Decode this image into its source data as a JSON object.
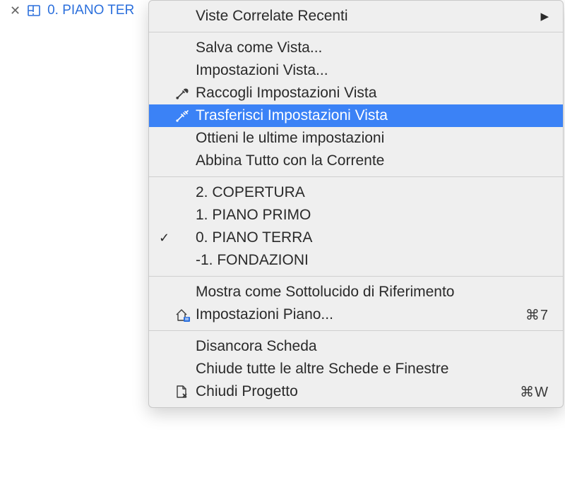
{
  "tab": {
    "label": "0. PIANO TER"
  },
  "menu": {
    "recentRelated": "Viste Correlate Recenti",
    "saveAsView": "Salva come Vista...",
    "viewSettings": "Impostazioni Vista...",
    "gatherViewSettings": "Raccogli Impostazioni Vista",
    "transferViewSettings": "Trasferisci Impostazioni Vista",
    "getLatestSettings": "Ottieni le ultime impostazioni",
    "matchAllWithCurrent": "Abbina Tutto con la Corrente",
    "stories": [
      {
        "label": "2. COPERTURA",
        "checked": false
      },
      {
        "label": "1. PIANO PRIMO",
        "checked": false
      },
      {
        "label": "0. PIANO TERRA",
        "checked": true
      },
      {
        "label": "-1. FONDAZIONI",
        "checked": false
      }
    ],
    "showAsTraceRef": "Mostra come Sottolucido di Riferimento",
    "storySettings": "Impostazioni Piano...",
    "storySettingsShortcut": "⌘7",
    "undockTab": "Disancora Scheda",
    "closeAllOtherTabs": "Chiude tutte le altre Schede e Finestre",
    "closeProject": "Chiudi Progetto",
    "closeProjectShortcut": "⌘W"
  }
}
